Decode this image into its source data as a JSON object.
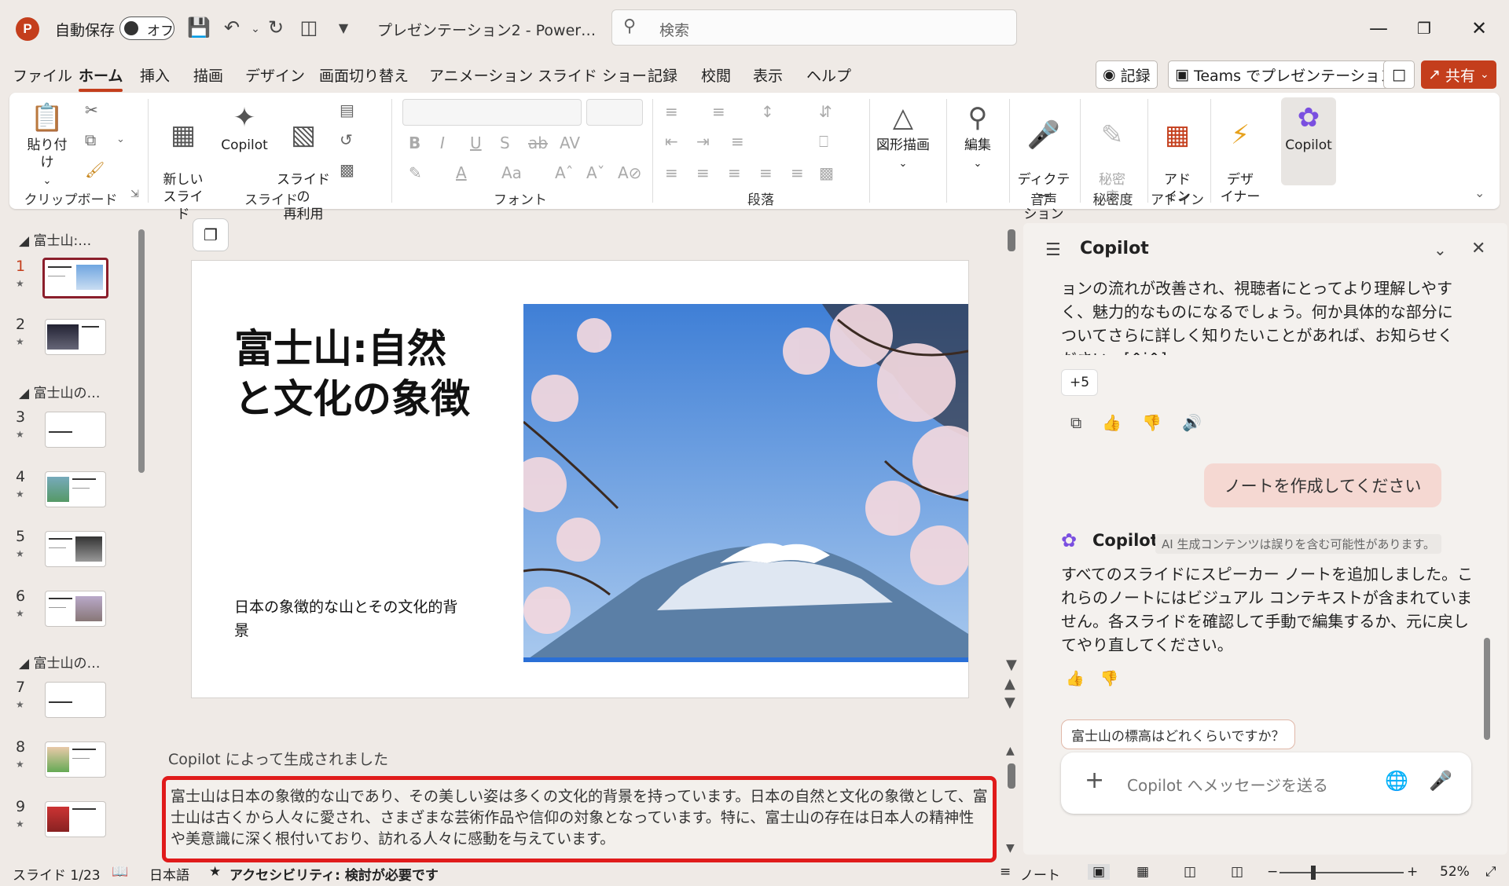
{
  "titlebar": {
    "app_letter": "P",
    "autosave_label": "自動保存",
    "autosave_state": "オフ",
    "doc_title": "プレゼンテーション2 - Power…",
    "search_placeholder": "検索"
  },
  "menu": {
    "tabs": [
      "ファイル",
      "ホーム",
      "挿入",
      "描画",
      "デザイン",
      "画面切り替え",
      "アニメーション",
      "スライド ショー",
      "記録",
      "校閲",
      "表示",
      "ヘルプ"
    ],
    "active": "ホーム",
    "record_label": "記録",
    "teams_label": "Teams でプレゼンテーション",
    "share_label": "共有"
  },
  "ribbon": {
    "paste_label": "貼り付け",
    "clipboard_group": "クリップボード",
    "new_slide_label": "新しい\nスライド",
    "copilot_label": "Copilot",
    "reuse_label": "スライドの\n再利用",
    "slide_group": "スライド",
    "font_group": "フォント",
    "paragraph_group": "段落",
    "shapes_label": "図形描画",
    "edit_label": "編集",
    "dictate_label": "ディクテー\nション",
    "voice_group": "音声",
    "sensitivity_label": "秘密\n度",
    "sensitivity_group": "秘密度",
    "addin_label": "アド\nイン",
    "addin_group": "アドイン",
    "designer_label": "デザ\nイナー",
    "copilot_btn_label": "Copilot"
  },
  "thumbnails": {
    "sections": [
      "富士山:…",
      "富士山の…",
      "富士山の…"
    ],
    "slides": [
      1,
      2,
      3,
      4,
      5,
      6,
      7,
      8,
      9
    ],
    "selected": 1
  },
  "slide": {
    "title": "富士山:自然と文化の象徴",
    "subtitle": "日本の象徴的な山とその文化的背景"
  },
  "notes": {
    "label": "Copilot によって生成されました",
    "text": "富士山は日本の象徴的な山であり、その美しい姿は多くの文化的背景を持っています。日本の自然と文化の象徴として、富士山は古くから人々に愛され、さまざまな芸術作品や信仰の対象となっています。特に、富士山の存在は日本人の精神性や美意識に深く根付いており、訪れる人々に感動を与えています。"
  },
  "copilot": {
    "title": "Copilot",
    "prev_message": "ョンの流れが改善され、視聴者にとってより理解しやすく、魅力的なものになるでしょう。何か具体的な部分についてさらに詳しく知りたいことがあれば、お知らせください。[^i^]",
    "more_label": "+5",
    "user_message": "ノートを作成してください",
    "sender": "Copilot",
    "ai_note": "AI 生成コンテンツは誤りを含む可能性があります。",
    "reply": "すべてのスライドにスピーカー ノートを追加しました。これらのノートにはビジュアル コンテキストが含まれていません。各スライドを確認して手動で編集するか、元に戻してやり直してください。",
    "suggestion": "富士山の標高はどれくらいですか？",
    "input_placeholder": "Copilot へメッセージを送る"
  },
  "status": {
    "slide_counter": "スライド 1/23",
    "language": "日本語",
    "accessibility": "アクセシビリティ: 検討が必要です",
    "notes_label": "ノート",
    "zoom": "52%"
  },
  "colors": {
    "accent": "#c43e1c",
    "highlight": "#e01b1b",
    "bubble": "#f5d8d2"
  }
}
